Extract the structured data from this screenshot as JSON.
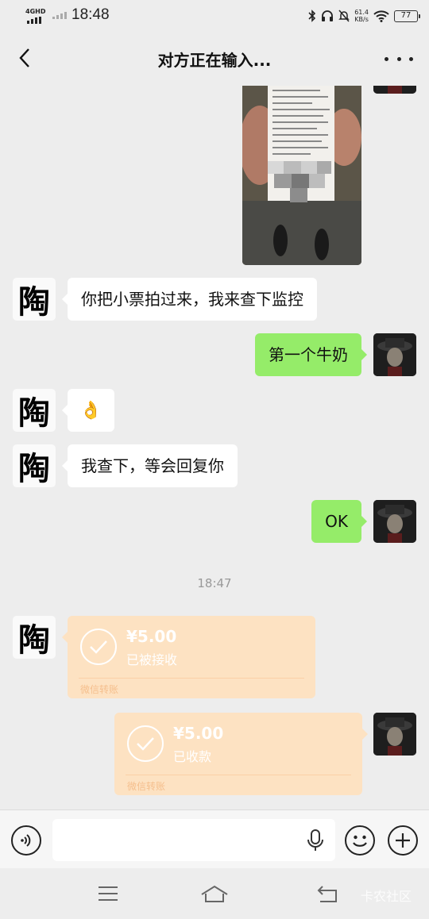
{
  "status_bar": {
    "network_label": "4GHD",
    "time": "18:48",
    "net_speed_value": "61.4",
    "net_speed_unit": "KB/s",
    "battery": "77",
    "icons": [
      "bluetooth-icon",
      "headphones-icon",
      "mute-icon",
      "wifi-icon",
      "battery-icon"
    ]
  },
  "header": {
    "title": "对方正在输入..."
  },
  "contacts": {
    "them_avatar_char": "陶"
  },
  "messages": [
    {
      "from": "them",
      "type": "image",
      "description_visible": "receipt photo"
    },
    {
      "from": "them",
      "type": "text",
      "text": "你把小票拍过来，我来查下监控"
    },
    {
      "from": "me",
      "type": "text",
      "text": "第一个牛奶"
    },
    {
      "from": "them",
      "type": "emoji",
      "text": "👌"
    },
    {
      "from": "them",
      "type": "text",
      "text": "我查下，等会回复你"
    },
    {
      "from": "me",
      "type": "text",
      "text": "OK"
    },
    {
      "type": "timestamp",
      "text": "18:47"
    },
    {
      "from": "them",
      "type": "transfer",
      "amount": "¥5.00",
      "status": "已被接收",
      "label": "微信转账"
    },
    {
      "from": "me",
      "type": "transfer",
      "amount": "¥5.00",
      "status": "已收款",
      "label": "微信转账"
    }
  ],
  "input": {
    "value": "",
    "placeholder": ""
  },
  "watermark": "卡农社区",
  "colors": {
    "background": "#ededed",
    "bubble_out": "#95ec69",
    "bubble_in": "#ffffff",
    "transfer": "#fde2c2"
  }
}
